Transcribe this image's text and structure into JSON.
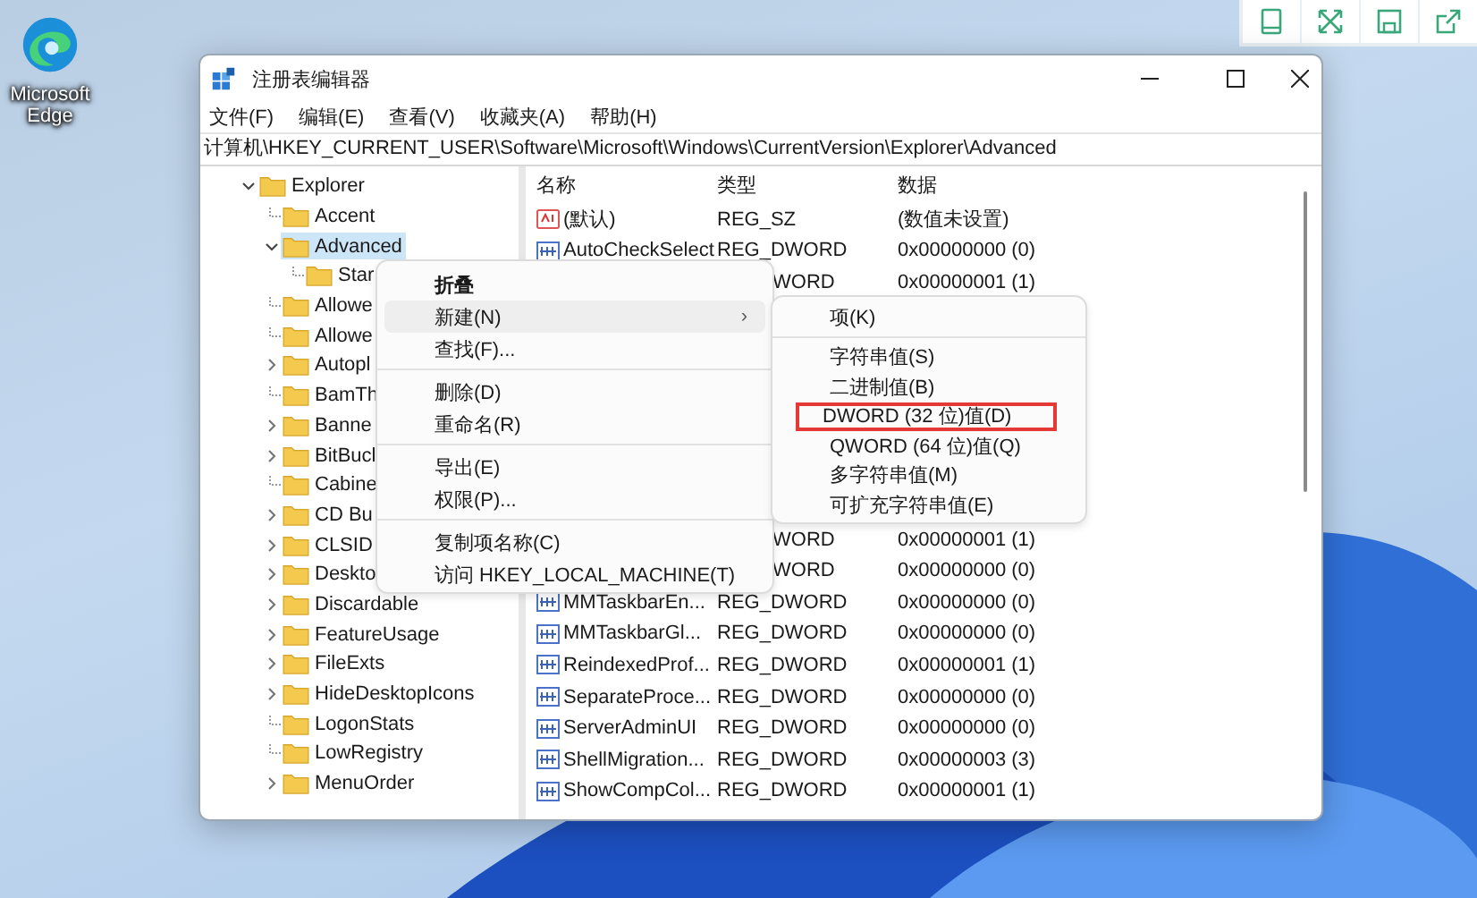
{
  "desktop": {
    "icons": [
      {
        "label": "Microsoft Edge"
      }
    ]
  },
  "window": {
    "title": "注册表编辑器",
    "menu": [
      "文件(F)",
      "编辑(E)",
      "查看(V)",
      "收藏夹(A)",
      "帮助(H)"
    ],
    "address": "计算机\\HKEY_CURRENT_USER\\Software\\Microsoft\\Windows\\CurrentVersion\\Explorer\\Advanced"
  },
  "tree": {
    "items": [
      {
        "label": "Explorer",
        "kind": "expanded",
        "selected": false,
        "children": [
          {
            "label": "Accent",
            "kind": "leaf",
            "selected": false
          },
          {
            "label": "Advanced",
            "kind": "expanded",
            "selected": true,
            "children": [
              {
                "label": "Star",
                "kind": "leaf",
                "selected": false
              }
            ]
          },
          {
            "label": "Allowe",
            "kind": "leaf",
            "selected": false
          },
          {
            "label": "Allowe",
            "kind": "leaf",
            "selected": false
          },
          {
            "label": "Autopl",
            "kind": "collapsed",
            "selected": false
          },
          {
            "label": "BamTh",
            "kind": "leaf",
            "selected": false
          },
          {
            "label": "Banne",
            "kind": "collapsed",
            "selected": false
          },
          {
            "label": "BitBucl",
            "kind": "collapsed",
            "selected": false
          },
          {
            "label": "Cabine",
            "kind": "leaf",
            "selected": false
          },
          {
            "label": "CD Bu",
            "kind": "collapsed",
            "selected": false
          },
          {
            "label": "CLSID",
            "kind": "collapsed",
            "selected": false
          },
          {
            "label": "Deskto",
            "kind": "collapsed",
            "selected": false
          },
          {
            "label": "Discardable",
            "kind": "collapsed",
            "selected": false
          },
          {
            "label": "FeatureUsage",
            "kind": "collapsed",
            "selected": false
          },
          {
            "label": "FileExts",
            "kind": "collapsed",
            "selected": false
          },
          {
            "label": "HideDesktopIcons",
            "kind": "collapsed",
            "selected": false
          },
          {
            "label": "LogonStats",
            "kind": "leaf",
            "selected": false
          },
          {
            "label": "LowRegistry",
            "kind": "leaf",
            "selected": false
          },
          {
            "label": "MenuOrder",
            "kind": "collapsed",
            "selected": false
          }
        ]
      }
    ]
  },
  "list": {
    "columns": [
      "名称",
      "类型",
      "数据"
    ],
    "rows_top": [
      {
        "kind": "string",
        "name": "(默认)",
        "type": "REG_SZ",
        "data": "(数值未设置)"
      },
      {
        "kind": "dword",
        "name": "AutoCheckSelect",
        "type": "REG_DWORD",
        "data": "0x00000000 (0)"
      },
      {
        "kind": "covered",
        "type": "WORD",
        "data": "0x00000001 (1)"
      }
    ],
    "rows_bottom": [
      {
        "kind": "covered",
        "type": "WORD",
        "data": "0x00000001 (1)"
      },
      {
        "kind": "covered",
        "type": "WORD",
        "data": "0x00000000 (0)"
      },
      {
        "kind": "dword",
        "name": "MMTaskbarEn...",
        "type": "REG_DWORD",
        "data": "0x00000000 (0)"
      },
      {
        "kind": "dword",
        "name": "MMTaskbarGl...",
        "type": "REG_DWORD",
        "data": "0x00000000 (0)"
      },
      {
        "kind": "dword",
        "name": "ReindexedProf...",
        "type": "REG_DWORD",
        "data": "0x00000001 (1)"
      },
      {
        "kind": "dword",
        "name": "SeparateProce...",
        "type": "REG_DWORD",
        "data": "0x00000000 (0)"
      },
      {
        "kind": "dword",
        "name": "ServerAdminUI",
        "type": "REG_DWORD",
        "data": "0x00000000 (0)"
      },
      {
        "kind": "dword",
        "name": "ShellMigration...",
        "type": "REG_DWORD",
        "data": "0x00000003 (3)"
      },
      {
        "kind": "dword",
        "name": "ShowCompCol...",
        "type": "REG_DWORD",
        "data": "0x00000001 (1)"
      }
    ]
  },
  "context_menu": {
    "items": [
      {
        "kind": "item",
        "label": "折叠",
        "bold": true,
        "highlighted": false
      },
      {
        "kind": "item",
        "label": "新建(N)",
        "arrow": "›",
        "bold": false,
        "highlighted": true
      },
      {
        "kind": "item",
        "label": "查找(F)...",
        "bold": false,
        "highlighted": false
      },
      {
        "kind": "separator"
      },
      {
        "kind": "item",
        "label": "删除(D)",
        "bold": false,
        "highlighted": false
      },
      {
        "kind": "item",
        "label": "重命名(R)",
        "bold": false,
        "highlighted": false
      },
      {
        "kind": "separator"
      },
      {
        "kind": "item",
        "label": "导出(E)",
        "bold": false,
        "highlighted": false
      },
      {
        "kind": "item",
        "label": "权限(P)...",
        "bold": false,
        "highlighted": false
      },
      {
        "kind": "separator"
      },
      {
        "kind": "item",
        "label": "复制项名称(C)",
        "bold": false,
        "highlighted": false
      },
      {
        "kind": "item",
        "label": "访问 HKEY_LOCAL_MACHINE(T)",
        "bold": false,
        "highlighted": false
      }
    ]
  },
  "submenu": {
    "items": [
      {
        "kind": "item",
        "label": "项(K)",
        "marked": false
      },
      {
        "kind": "separator"
      },
      {
        "kind": "item",
        "label": "字符串值(S)",
        "marked": false
      },
      {
        "kind": "item",
        "label": "二进制值(B)",
        "marked": false
      },
      {
        "kind": "item",
        "label": "DWORD (32 位)值(D)",
        "marked": true
      },
      {
        "kind": "item",
        "label": "QWORD (64 位)值(Q)",
        "marked": false
      },
      {
        "kind": "item",
        "label": "多字符串值(M)",
        "marked": false
      },
      {
        "kind": "item",
        "label": "可扩充字符串值(E)",
        "marked": false
      }
    ]
  }
}
